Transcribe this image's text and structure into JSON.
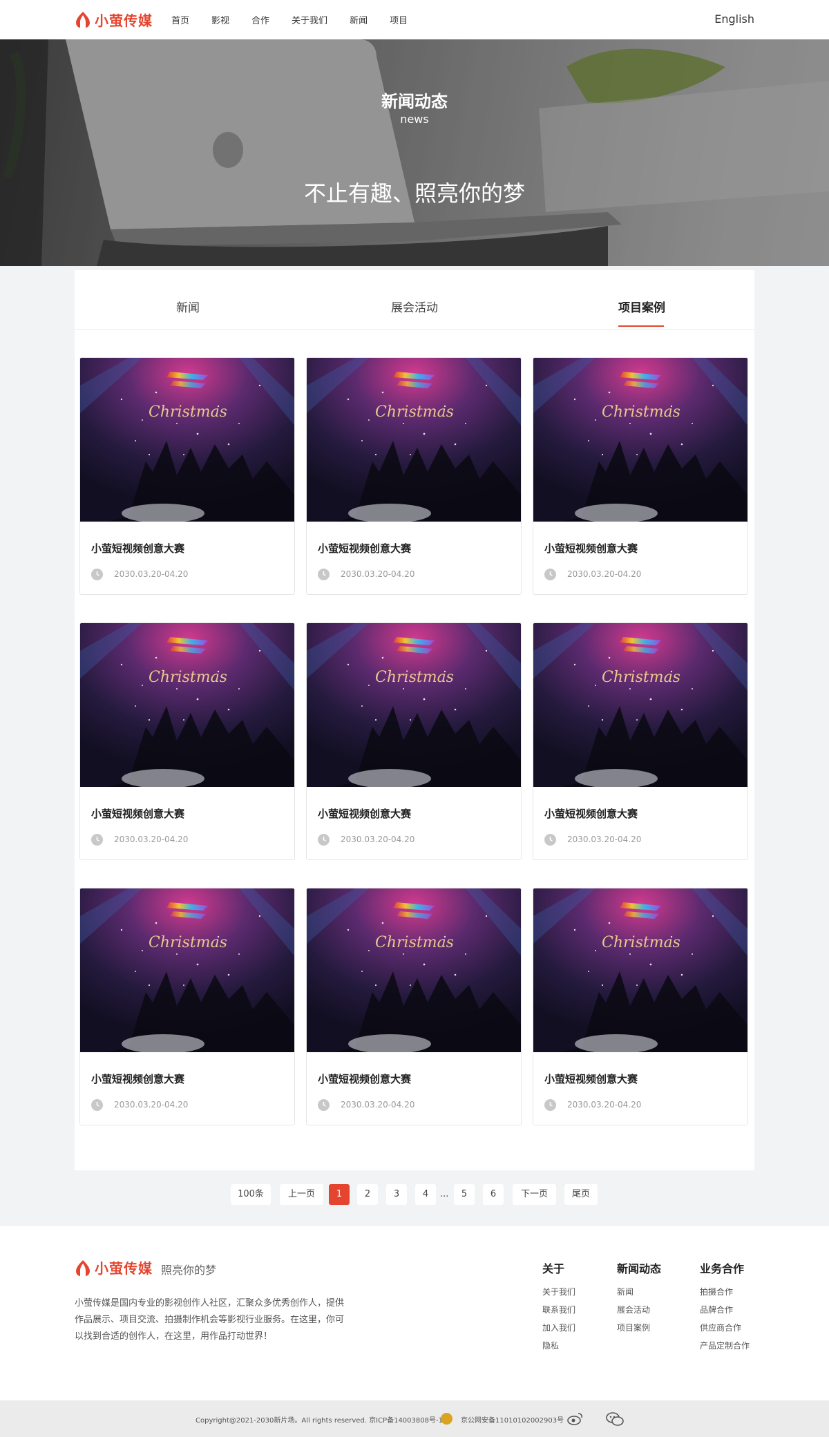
{
  "header": {
    "logo_text": "小萤传媒",
    "nav": [
      "首页",
      "影视",
      "合作",
      "关于我们",
      "新闻",
      "项目"
    ],
    "lang": "English"
  },
  "banner": {
    "title": "新闻动态",
    "subtitle": "news",
    "slogan": "不止有趣、照亮你的梦"
  },
  "tabs": [
    {
      "label": "新闻",
      "active": false
    },
    {
      "label": "展会活动",
      "active": false
    },
    {
      "label": "项目案例",
      "active": true
    }
  ],
  "cards": [
    {
      "title": "小萤短视频创意大赛",
      "date": "2030.03.20-04.20"
    },
    {
      "title": "小萤短视频创意大赛",
      "date": "2030.03.20-04.20"
    },
    {
      "title": "小萤短视频创意大赛",
      "date": "2030.03.20-04.20"
    },
    {
      "title": "小萤短视频创意大赛",
      "date": "2030.03.20-04.20"
    },
    {
      "title": "小萤短视频创意大赛",
      "date": "2030.03.20-04.20"
    },
    {
      "title": "小萤短视频创意大赛",
      "date": "2030.03.20-04.20"
    },
    {
      "title": "小萤短视频创意大赛",
      "date": "2030.03.20-04.20"
    },
    {
      "title": "小萤短视频创意大赛",
      "date": "2030.03.20-04.20"
    },
    {
      "title": "小萤短视频创意大赛",
      "date": "2030.03.20-04.20"
    }
  ],
  "card_image_text": "Christmas",
  "pagination": {
    "total": "100条",
    "prev": "上一页",
    "pages": [
      "1",
      "2",
      "3",
      "4",
      "5",
      "6"
    ],
    "current": "1",
    "ellipsis": "...",
    "next": "下一页",
    "last": "尾页"
  },
  "footer": {
    "logo_text": "小萤传媒",
    "slogan": "照亮你的梦",
    "description": "小萤传媒是国内专业的影视创作人社区，汇聚众多优秀创作人，提供作品展示、项目交流、拍摄制作机会等影视行业服务。在这里，你可以找到合适的创作人，在这里，用作品打动世界！",
    "columns": [
      {
        "title": "关于",
        "links": [
          "关于我们",
          "联系我们",
          "加入我们",
          "隐私"
        ]
      },
      {
        "title": "新闻动态",
        "links": [
          "新闻",
          "展会活动",
          "项目案例"
        ]
      },
      {
        "title": "业务合作",
        "links": [
          "拍摄合作",
          "品牌合作",
          "供应商合作",
          "产品定制合作"
        ]
      }
    ],
    "copyright": "Copyright@2021-2030新片场。All rights reserved. 京ICP备14003808号-1",
    "police": "京公网安备11010102002903号"
  },
  "colors": {
    "accent": "#e5452f"
  }
}
